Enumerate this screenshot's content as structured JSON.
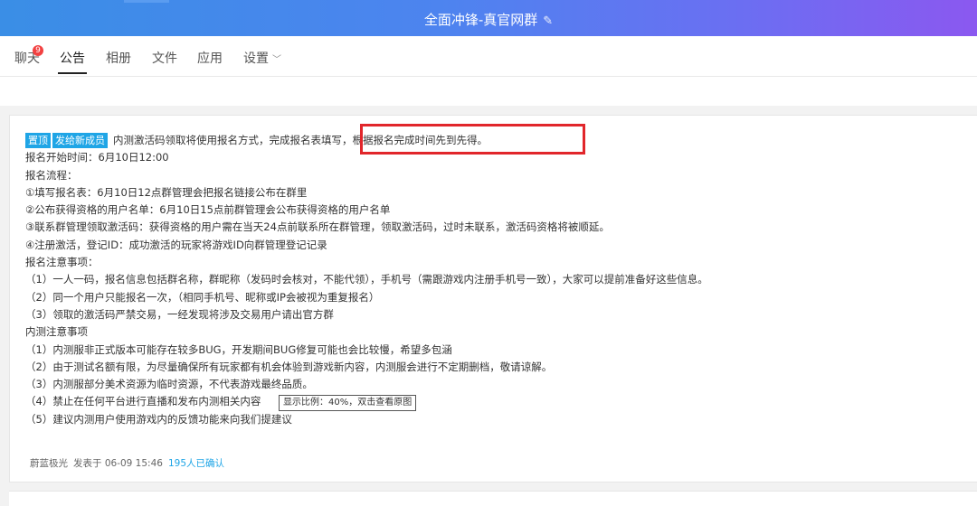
{
  "window": {
    "title": "全面冲锋-真官网群"
  },
  "tabs": [
    {
      "label": "聊天",
      "badge": "9"
    },
    {
      "label": "公告"
    },
    {
      "label": "相册"
    },
    {
      "label": "文件"
    },
    {
      "label": "应用"
    },
    {
      "label": "设置"
    }
  ],
  "notice": {
    "tags": [
      "置顶",
      "发给新成员"
    ],
    "lines": [
      "内测激活码领取将使用报名方式，完成报名表填写，根据报名完成时间先到先得。",
      "报名开始时间：6月10日12:00",
      "报名流程：",
      "①填写报名表：6月10日12点群管理会把报名链接公布在群里",
      "②公布获得资格的用户名单：6月10日15点前群管理会公布获得资格的用户名单",
      "③联系群管理领取激活码：获得资格的用户需在当天24点前联系所在群管理，领取激活码，过时未联系，激活码资格将被顺延。",
      "④注册激活，登记ID：成功激活的玩家将游戏ID向群管理登记记录",
      "报名注意事项：",
      "（1）一人一码，报名信息包括群名称，群昵称（发码时会核对，不能代领），手机号（需跟游戏内注册手机号一致），大家可以提前准备好这些信息。",
      "（2）同一个用户只能报名一次，（相同手机号、昵称或IP会被视为重复报名）",
      "（3）领取的激活码严禁交易，一经发现将涉及交易用户请出官方群",
      "内测注意事项",
      "（1）内测服非正式版本可能存在较多BUG，开发期间BUG修复可能也会比较慢，希望多包涵",
      "（2）由于测试名额有限，为尽量确保所有玩家都有机会体验到游戏新内容，内测服会进行不定期删档，敬请谅解。",
      "（3）内测服部分美术资源为临时资源，不代表游戏最终品质。",
      "（4）禁止在任何平台进行直播和发布内测相关内容",
      "（5）建议内测用户使用游戏内的反馈功能来向我们提建议"
    ],
    "tooltip": "显示比例：40%，双击查看原图",
    "author": "蔚蓝极光",
    "posted": "发表于 06-09 15:46",
    "confirmed": "195人已确认"
  },
  "colors": {
    "accent": "#1fa5e6",
    "highlight_box": "#e1262b",
    "titlebar_start": "#3a8ee6",
    "titlebar_end": "#8b58f0"
  },
  "icons": {
    "title_edit": "edit-icon",
    "settings_dropdown": "chevron-down-icon"
  }
}
